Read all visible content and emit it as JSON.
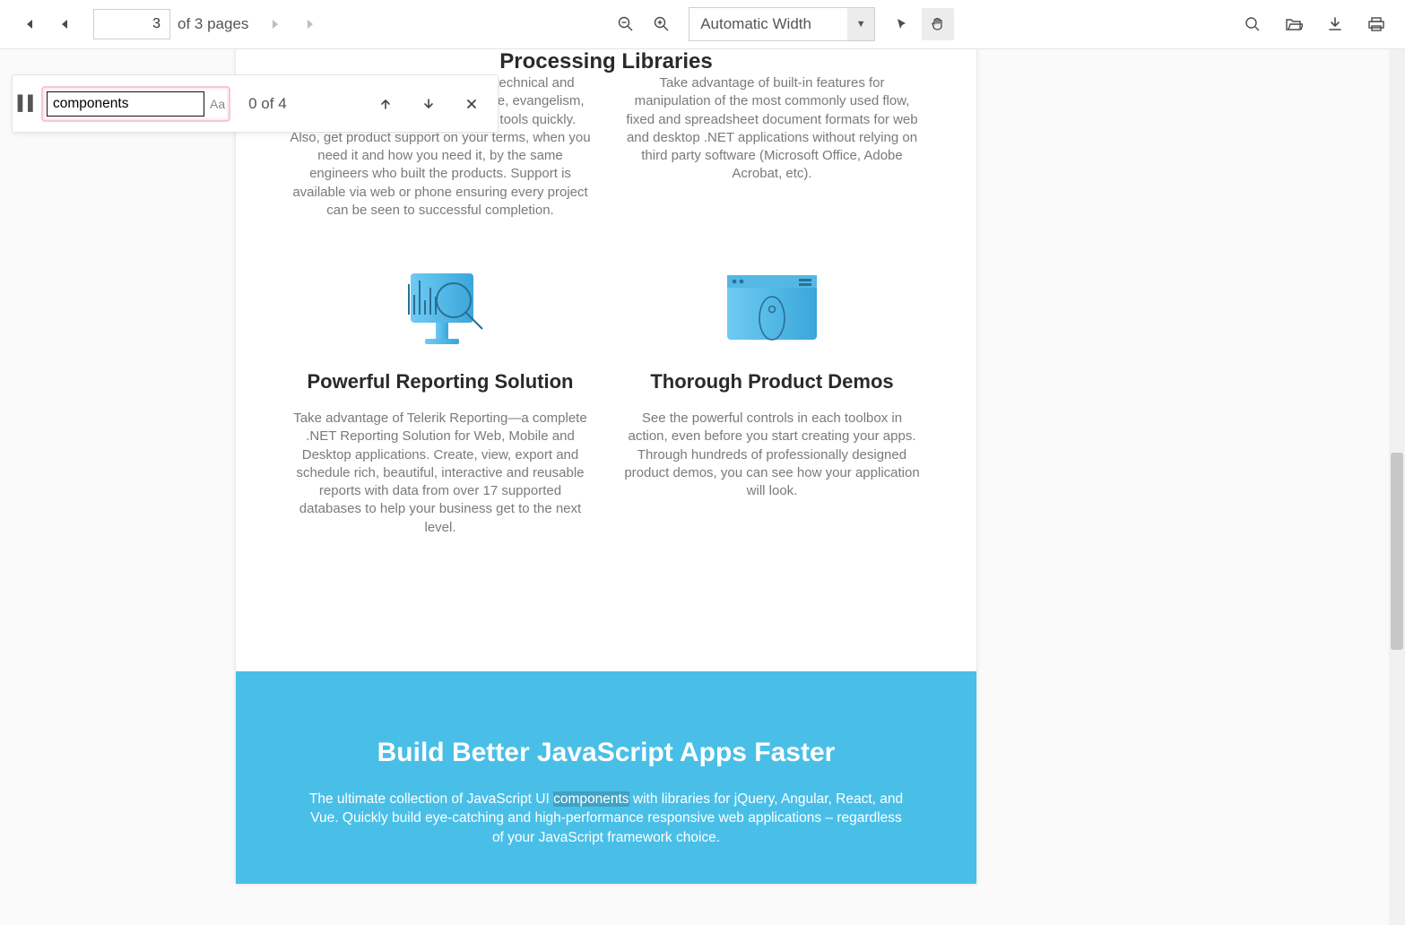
{
  "toolbar": {
    "page_input_value": "3",
    "page_count_label": "of 3 pages",
    "zoom_mode": "Automatic Width"
  },
  "find": {
    "query": "components",
    "match_count_label": "0 of 4",
    "case_label": "Aa"
  },
  "doc": {
    "partial_heading": "Processing Libraries",
    "col1": {
      "top_body": "Industry-leading, five-star rated technical and account management team license, evangelism, training, and successful with our tools quickly. Also, get product support on your terms, when you need it and how you need it, by the same engineers who built the products. Support is available via web or phone ensuring every project can be seen to successful completion.",
      "mid_title": "Powerful Reporting Solution",
      "mid_body": "Take advantage of Telerik Reporting—a complete .NET Reporting Solution for Web, Mobile and Desktop applications. Create, view, export and schedule rich, beautiful, interactive and reusable reports with data from over 17 supported databases to help your business get to the next level."
    },
    "col2": {
      "top_body": "Take advantage of built-in features for manipulation of the most commonly used flow, fixed and spreadsheet document formats for web and desktop .NET applications without relying on third party software (Microsoft Office, Adobe Acrobat, etc).",
      "mid_title": "Thorough Product Demos",
      "mid_body": "See the powerful controls in each toolbox in action, even before you start creating your apps. Through hundreds of professionally designed product demos, you can see how your application will look."
    },
    "banner": {
      "title": "Build Better JavaScript Apps Faster",
      "body_pre": "The ultimate collection of JavaScript UI ",
      "body_hl": "components",
      "body_post": " with libraries for jQuery, Angular, React, and Vue. Quickly build eye-catching and high-performance responsive web applications – regardless of your JavaScript framework choice."
    }
  }
}
